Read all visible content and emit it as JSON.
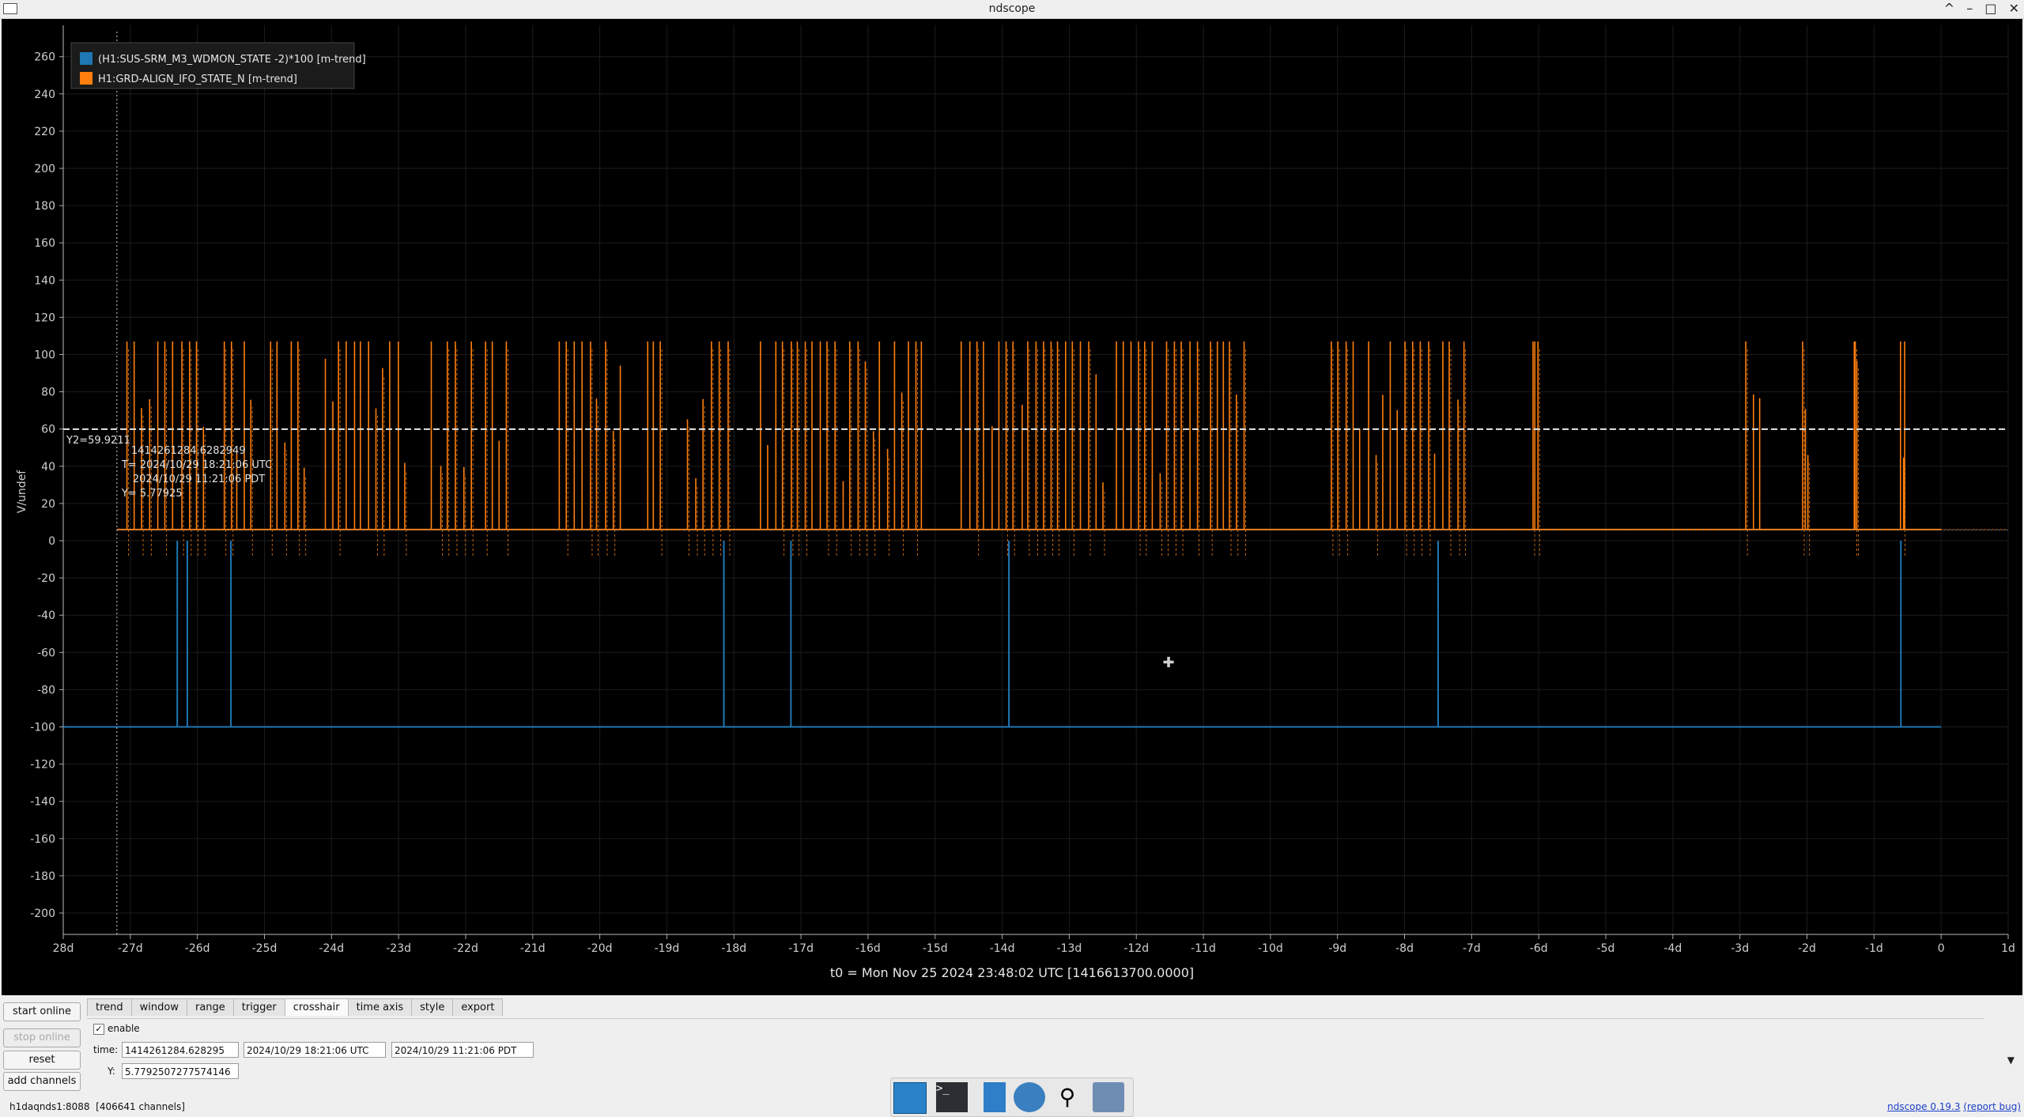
{
  "window": {
    "title": "ndscope"
  },
  "legend": [
    {
      "label": "(H1:SUS-SRM_M3_WDMON_STATE -2)*100 [m-trend]",
      "color": "#1f77b4"
    },
    {
      "label": "H1:GRD-ALIGN_IFO_STATE_N [m-trend]",
      "color": "#ff7f0e"
    }
  ],
  "plot": {
    "ylabel": "V/undef",
    "y_ticks": [
      "260",
      "240",
      "220",
      "200",
      "180",
      "160",
      "140",
      "120",
      "100",
      "80",
      "60",
      "40",
      "20",
      "0",
      "-20",
      "-40",
      "-60",
      "-80",
      "-100",
      "-120",
      "-140",
      "-160",
      "-180",
      "-200"
    ],
    "x_ticks": [
      "28d",
      "-27d",
      "-26d",
      "-25d",
      "-24d",
      "-23d",
      "-22d",
      "-21d",
      "-20d",
      "-19d",
      "-18d",
      "-17d",
      "-16d",
      "-15d",
      "-14d",
      "-13d",
      "-12d",
      "-11d",
      "-10d",
      "-9d",
      "-8d",
      "-7d",
      "-6d",
      "-5d",
      "-4d",
      "-3d",
      "-2d",
      "-1d",
      "0",
      "1d"
    ],
    "t0_label": "t0 = Mon Nov 25 2024 23:48:02 UTC [1416613700.0000]",
    "y2_label": "Y2=59.9211",
    "cursor": {
      "gps": "1414261284.6282949",
      "utc": "T= 2024/10/29 18:21:06 UTC",
      "pdt": "2024/10/29 11:21:06 PDT",
      "y": "Y= 5.77925"
    }
  },
  "chart_data": {
    "type": "line",
    "xlabel": "",
    "ylabel": "V/undef",
    "xlim_days": [
      -28,
      1
    ],
    "ylim": [
      -210,
      270
    ],
    "grid": true,
    "legend_position": "top-left",
    "series": [
      {
        "name": "(H1:SUS-SRM_M3_WDMON_STATE -2)*100 [m-trend]",
        "baseline": -100,
        "spikes_to_zero_at_days": [
          -26.3,
          -26.15,
          -25.5,
          -18.15,
          -17.15,
          -13.9,
          -7.5,
          -0.6
        ]
      },
      {
        "name": "H1:GRD-ALIGN_IFO_STATE_N [m-trend]",
        "baseline": 6,
        "spike_top": 107,
        "spike_ranges_days": [
          [
            -27.05,
            -25.9
          ],
          [
            -25.6,
            -25.2
          ],
          [
            -24.9,
            -24.4
          ],
          [
            -24.1,
            -22.9
          ],
          [
            -22.5,
            -21.9
          ],
          [
            -21.7,
            -21.4
          ],
          [
            -20.6,
            -19.7
          ],
          [
            -19.3,
            -19.1
          ],
          [
            -18.7,
            -18.1
          ],
          [
            -17.6,
            -15.6
          ],
          [
            -15.5,
            -15.2
          ],
          [
            -14.6,
            -12.5
          ],
          [
            -12.3,
            -11.1
          ],
          [
            -10.9,
            -10.4
          ],
          [
            -9.1,
            -7.1
          ],
          [
            -6.1,
            -6.0
          ],
          [
            -2.9,
            -2.7
          ],
          [
            -2.05,
            -2.0
          ],
          [
            -1.3,
            -1.25
          ],
          [
            -0.6,
            -0.55
          ]
        ]
      }
    ],
    "reference_lines": [
      {
        "name": "Y2",
        "y": 59.9211
      },
      {
        "name": "crosshair_x",
        "x_days": -27.2
      }
    ]
  },
  "tabs": [
    "trend",
    "window",
    "range",
    "trigger",
    "crosshair",
    "time axis",
    "style",
    "export"
  ],
  "active_tab": "crosshair",
  "buttons": {
    "start_online": "start online",
    "stop_online": "stop online",
    "reset": "reset",
    "add_channels": "add channels"
  },
  "crosshair_panel": {
    "enable_label": "enable",
    "time_label": "time:",
    "time_gps": "1414261284.628295",
    "time_utc": "2024/10/29 18:21:06 UTC",
    "time_pdt": "2024/10/29 11:21:06 PDT",
    "y_label": "Y:",
    "y_value": "5.7792507277574146"
  },
  "status": {
    "server": "h1daqnds1:8088",
    "channels": "[406641 channels]",
    "version_link": "ndscope 0.19.3",
    "report_bug": "(report bug)"
  }
}
